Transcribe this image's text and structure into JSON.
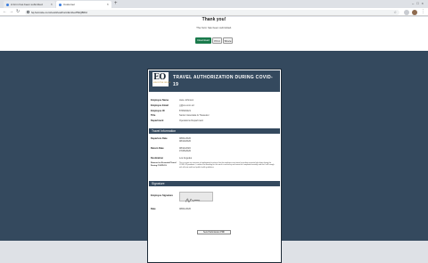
{
  "browser": {
    "tabs": [
      {
        "label": "A form has been submitted"
      },
      {
        "label": "Customer"
      }
    ],
    "url": "hq.formsite.com/res/showFormEmbed?EQBRd"
  },
  "banner": {
    "title": "Thank you!",
    "message": "The form has been submitted.",
    "buttons": {
      "primary": "Download",
      "print": "Print",
      "share": "Share"
    }
  },
  "form": {
    "logo": {
      "main": "EO",
      "sub": "EXECUTIVE OFFICE"
    },
    "title": "TRAVEL AUTHORIZATION DURING COVID-19",
    "employee_fields": [
      {
        "label": "Employee Name",
        "value": "Jane Johnson"
      },
      {
        "label": "Employee Email",
        "value": "j.j@eo.com.sd"
      },
      {
        "label": "Employee ID",
        "value": "870919221"
      },
      {
        "label": "Title",
        "value": "Senior Associate & Treasurer"
      },
      {
        "label": "Department",
        "value": "Operations Department"
      }
    ],
    "travel_section": "Travel Information",
    "travel_fields": [
      {
        "label": "Departure Date",
        "value": "08/01/2020\n08/10/2020"
      },
      {
        "label": "Return Date",
        "value": "08/11/2020\n07/25/2020"
      },
      {
        "label": "Destination",
        "value": "Los Angeles"
      },
      {
        "label": "Reason for Essential Travel During COVID-19",
        "value": "This is to give an overview of employment functions that the employee must travel to perform essential job duties during the COVID-19 pandemic. I confirm that traveling for this work is necessary and cannot be completed remotely and that I will comply with all state and local public health guidelines."
      }
    ],
    "signature_section": "Signature",
    "signature_fields": [
      {
        "label": "Employee Signature"
      },
      {
        "label": "Date",
        "value": "08/01/2020"
      }
    ]
  },
  "footer_button": "Send Submission PDF"
}
